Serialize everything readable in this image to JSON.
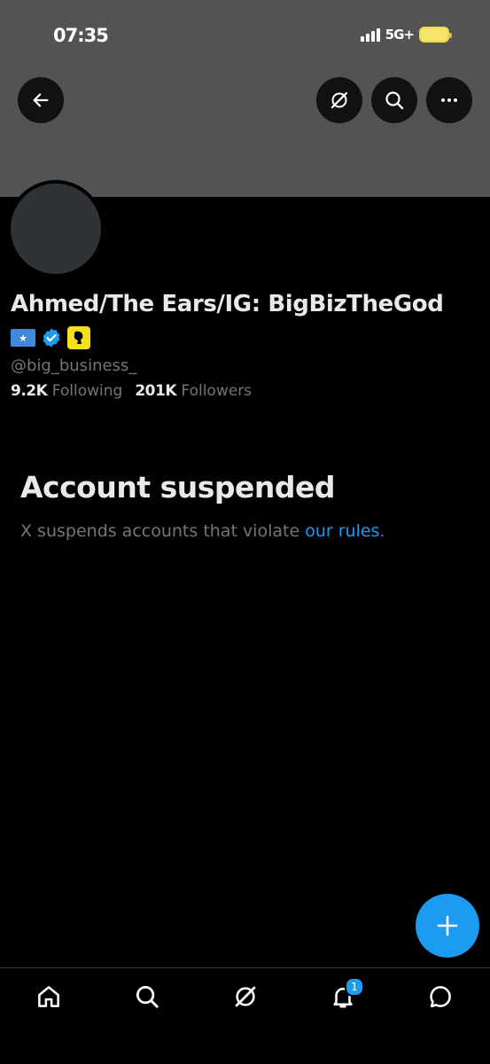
{
  "status_bar": {
    "time": "07:35",
    "network": "5G+"
  },
  "header": {
    "back_icon": "arrow-left-icon",
    "grok_icon": "grok-icon",
    "search_icon": "search-icon",
    "more_icon": "more-horizontal-icon"
  },
  "profile": {
    "display_name": "Ahmed/The Ears/IG: BigBizTheGod",
    "handle": "@big_business_",
    "badges": [
      "somalia-flag-icon",
      "verified-badge-icon",
      "affiliate-badge-icon"
    ],
    "following_count": "9.2K",
    "following_label": "Following",
    "followers_count": "201K",
    "followers_label": "Followers"
  },
  "suspension": {
    "title": "Account suspended",
    "description": "X suspends accounts that violate ",
    "link_text": "our rules",
    "trailing": "."
  },
  "fab": {
    "icon": "plus-icon"
  },
  "bottom_nav": {
    "items": [
      "home-icon",
      "search-icon",
      "grok-icon",
      "notifications-icon",
      "messages-icon"
    ],
    "notification_count": "1"
  },
  "colors": {
    "accent": "#1d9bf0",
    "background": "#000000",
    "banner": "#535353",
    "muted_text": "#71767b",
    "primary_text": "#e7e9ea"
  }
}
